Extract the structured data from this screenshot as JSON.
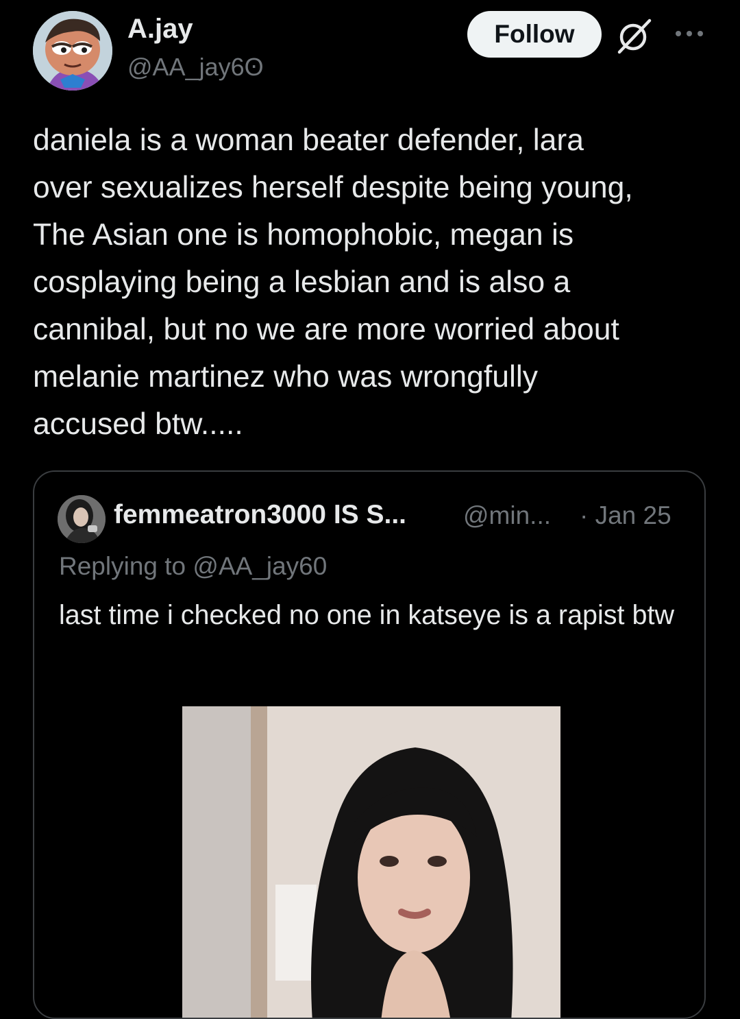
{
  "post": {
    "display_name": "A.jay",
    "handle": "@AA_jay6ʘ",
    "follow_label": "Follow",
    "text": "daniela is a woman beater defender, lara\nover sexualizes herself despite being young,\nThe Asian one is homophobic, megan is\ncosplaying being a lesbian and is also a\ncannibal, but no we are more worried about\nmelanie martinez who was wrongfully\naccused btw....."
  },
  "quote": {
    "display_name": "femmeatron3000 IS S...",
    "handle": "@min...",
    "date": "· Jan 25",
    "replying_to": "Replying to @AA_jay60",
    "text": "last time i checked no one in katseye is a rapist btw"
  },
  "colors": {
    "background": "#000000",
    "text_primary": "#e7e9ea",
    "text_secondary": "#71767b",
    "border": "#3a3d40",
    "follow_bg": "#eff3f4"
  },
  "icons": {
    "grok": "grok-icon",
    "more": "more-options-icon"
  }
}
